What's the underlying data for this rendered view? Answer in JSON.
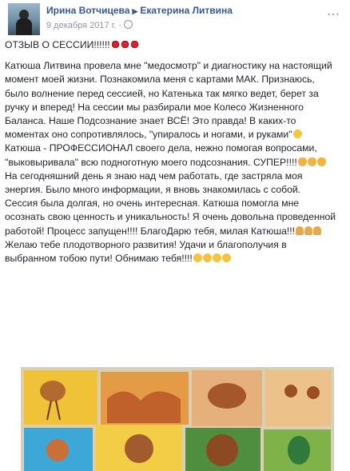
{
  "header": {
    "author": "Ирина Вотчицева",
    "recipient": "Екатерина Литвина",
    "date": "9 декабря 2017 г."
  },
  "post": {
    "title": "ОТЗЫВ О СЕССИИ!!!!!!",
    "lines": [
      "Катюша Литвина провела мне \"медосмотр\" и диагностику на настоящий",
      "момент моей жизни. Познакомила меня с картами МАК. Признаюсь,",
      "было волнение перед сессией, но Катенька так мягко ведет, берет за",
      "ручку и вперед! На сессии мы разбирали мое Колесо Жизненного",
      "Баланса. Наше Подсознание знает ВСЁ! Это правда! В каких-то",
      "моментах оно сопротивлялось, \"упиралось и ногами, и руками\"",
      "Катюша - ПРОФЕССИОНАЛ своего дела, нежно помогая вопросами,",
      "\"выковыривала\" всю подноготную моего подсознания. СУПЕР!!!!",
      "На сегодняшний день я знаю над чем работать, где застряла моя",
      "энергия. Было много информации, я вновь знакомилась с собой.",
      "Сессия была долгая, но очень интересная. Катюша помогла мне",
      "осознать свою ценность и уникальность! Я очень довольна проведенной",
      "работой! Процесс запущен!!!! БлагоДарю тебя, милая Катюша!!!",
      "Желаю тебе плодотворного развития! Удачи и благополучия в",
      "выбранном тобою пути! Обнимаю тебя!!!!"
    ]
  },
  "colors": {
    "link": "#365899",
    "meta": "#90949c",
    "text": "#1d2129"
  }
}
